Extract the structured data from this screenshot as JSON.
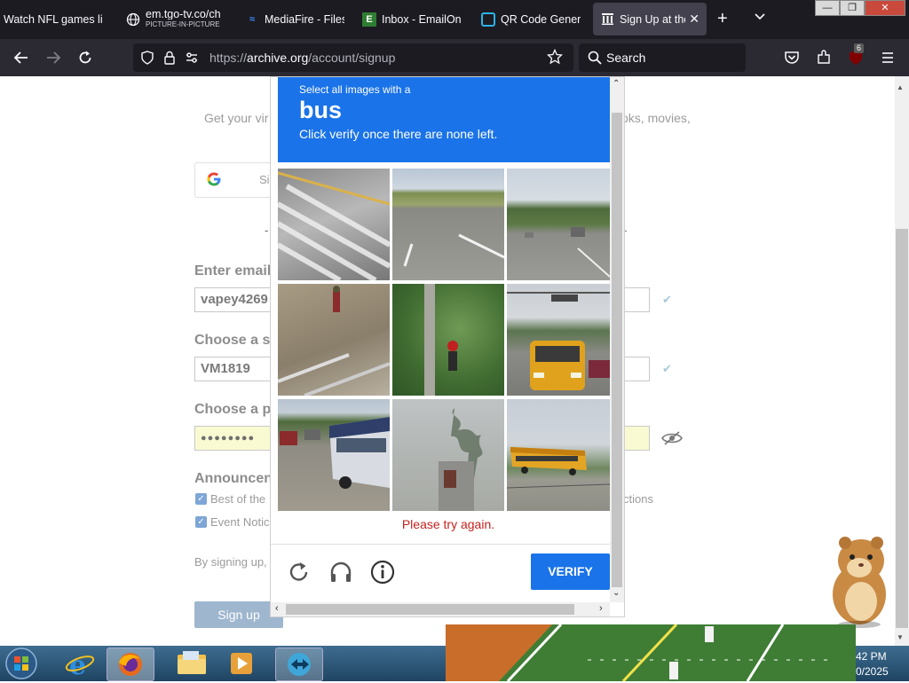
{
  "browser": {
    "tabs": [
      {
        "title": "Watch NFL games li",
        "favicon": "nfl-icon"
      },
      {
        "title": "em.tgo-tv.co/ch",
        "subtitle": "PICTURE-IN-PICTURE",
        "favicon": "globe-icon"
      },
      {
        "title": "MediaFire - Files",
        "favicon": "mediafire-icon"
      },
      {
        "title": "Inbox - EmailOnl",
        "favicon": "email-icon"
      },
      {
        "title": "QR Code Genera",
        "favicon": "qr-icon"
      },
      {
        "title": "Sign Up at the",
        "favicon": "archive-icon",
        "active": true
      }
    ],
    "url_prefix": "https://",
    "url_domain": "archive.org",
    "url_path": "/account/signup",
    "search_placeholder": "Search",
    "badge_count": "6"
  },
  "page": {
    "intro_text": "Get your vir",
    "intro_text_end": "oks, movies,",
    "google_button_label": "Si",
    "divider_left": "-",
    "divider_right": "-",
    "email_label": "Enter email",
    "email_value": "vapey4269",
    "screenname_label": "Choose a s",
    "screenname_value": "VM1819",
    "password_label": "Choose a p",
    "password_value": "●●●●●●●●",
    "announcements_label": "Announcen",
    "option1": "Best of the",
    "option1_end": "ctions",
    "option2": "Event Notic",
    "terms_text": "By signing up,",
    "signup_button": "Sign up"
  },
  "captcha": {
    "instruction": "Select all images with a",
    "target": "bus",
    "hint": "Click verify once there are none left.",
    "error": "Please try again.",
    "verify_label": "VERIFY"
  },
  "taskbar": {
    "clock_time": "42 PM",
    "clock_date": "0/2025"
  },
  "colors": {
    "captcha_blue": "#1a73e8",
    "error_red": "#c5221f",
    "browser_dark": "#1c1b22",
    "signup_button": "#9fb6cf"
  }
}
